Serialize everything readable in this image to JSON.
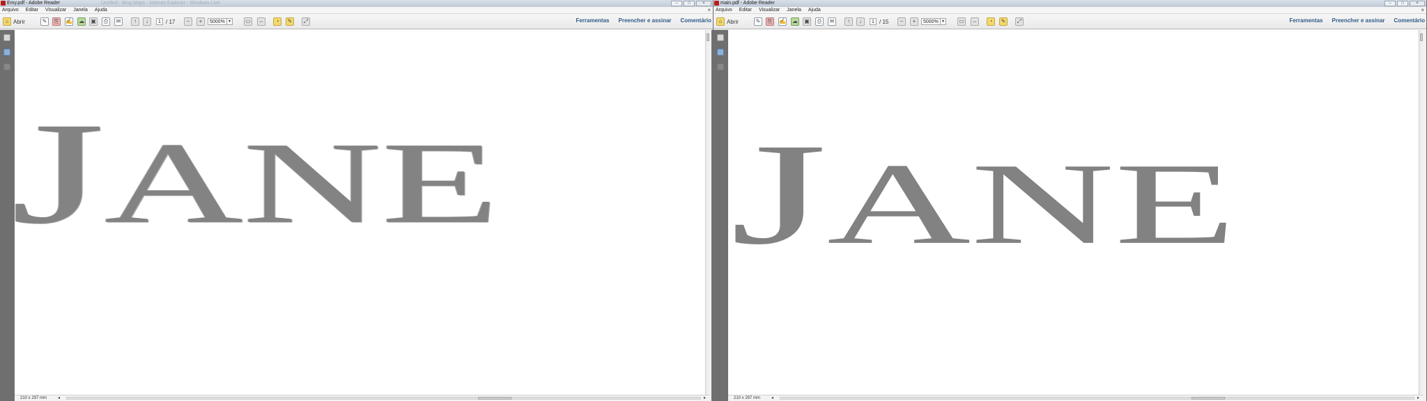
{
  "windows": [
    {
      "title": "Emy.pdf - Adobe Reader",
      "ghost_title": "Untitled - Bing Maps - Internet Explorer - Windows Live",
      "menus": [
        "Arquivo",
        "Editar",
        "Visualizar",
        "Janela",
        "Ajuda"
      ],
      "toolbar": {
        "open_label": "Abrir",
        "page_value": "1",
        "page_total": "/ 17",
        "zoom_value": "5000%",
        "right_links": [
          "Ferramentas",
          "Preencher e assinar",
          "Comentário"
        ]
      },
      "document": {
        "display_first": "J",
        "display_rest": "ANE"
      },
      "status": {
        "page_size": "210 x 297 mm"
      }
    },
    {
      "title": "main.pdf - Adobe Reader",
      "ghost_title": "",
      "menus": [
        "Arquivo",
        "Editar",
        "Visualizar",
        "Janela",
        "Ajuda"
      ],
      "toolbar": {
        "open_label": "Abrir",
        "page_value": "1",
        "page_total": "/ 15",
        "zoom_value": "5000%",
        "right_links": [
          "Ferramentas",
          "Preencher e assinar",
          "Comentário"
        ]
      },
      "document": {
        "display_first": "J",
        "display_rest": "ANE"
      },
      "status": {
        "page_size": "210 x 297 mm"
      }
    }
  ],
  "icons": {
    "window_minimize": "minimize-icon",
    "window_maximize": "maximize-icon",
    "window_close": "close-icon",
    "open_folder": "folder-icon",
    "pages_panel": "pages-icon",
    "bookmarks_panel": "bookmark-icon",
    "signature_panel": "pen-icon"
  },
  "colors": {
    "text_gray": "#828282",
    "link_blue": "#2f5b88",
    "nav_gray": "#6f6f6f",
    "title_bar": "#c9d2dd"
  }
}
